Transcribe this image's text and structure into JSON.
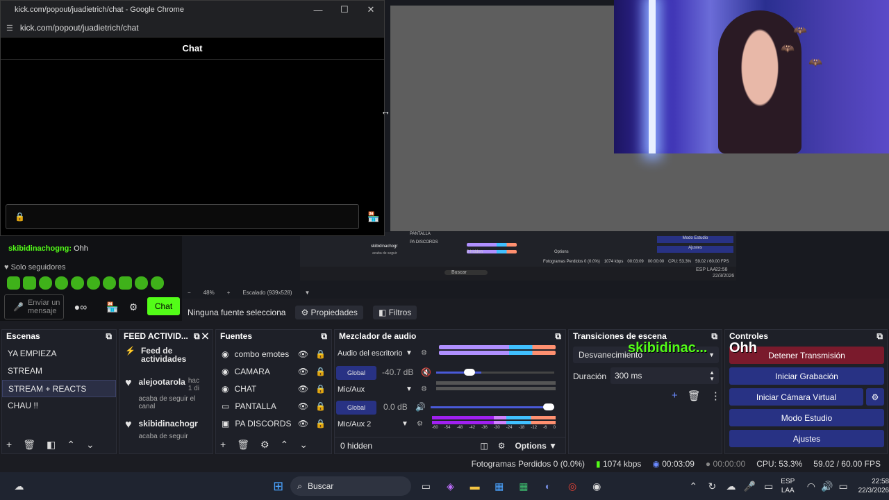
{
  "chrome_window": {
    "title": "kick.com/popout/juadietrich/chat - Google Chrome",
    "url": "kick.com/popout/juadietrich/chat",
    "chat_header": "Chat",
    "minimize": "—",
    "maximize": "☐",
    "close": "✕"
  },
  "kick_chat": {
    "message_user": "skibidinachogng:",
    "message_text": "Ohh",
    "followers_only": "Solo seguidores",
    "send_placeholder": "Enviar un mensaje",
    "chat_button": "Chat"
  },
  "mini_obs": {
    "scene_a": "PANTALLA",
    "scene_b": "PA DISCORDS",
    "user": "skibidinachogr",
    "follow": "acaba de seguir",
    "modo_estudio": "Modo Estudio",
    "ajustes": "Ajustes",
    "hidden": "0 hidden",
    "options": "Options",
    "search": "Buscar",
    "status": "Fotogramas Perdidos 0 (0.0%)",
    "kbps": "1074 kbps",
    "time1": "00:03:09",
    "time2": "00:00:00",
    "cpu": "CPU: 53.3%",
    "fps": "59.02 / 60.00 FPS",
    "lang": "ESP LAA",
    "clock": "22:58",
    "date": "22/3/2026"
  },
  "preview_toolbar": {
    "zoom": "48%",
    "scale": "Escalado (939x528)"
  },
  "source_bar": {
    "none_selected": "Ninguna fuente selecciona",
    "properties": "Propiedades",
    "filters": "Filtros"
  },
  "scenes": {
    "title": "Escenas",
    "items": [
      "YA EMPIEZA",
      "STREAM",
      "STREAM + REACTS",
      "CHAU !!"
    ],
    "selected_index": 2
  },
  "activity": {
    "title": "FEED ACTIVID...",
    "feed_label": "Feed de actividades",
    "entries": [
      {
        "user": "alejootarola",
        "time": "hac 1 di",
        "text": "acaba de seguir el canal"
      },
      {
        "user": "skibidinachogr",
        "text": "acaba de seguir"
      }
    ]
  },
  "sources": {
    "title": "Fuentes",
    "items": [
      "combo emotes",
      "CAMARA",
      "CHAT",
      "PANTALLA",
      "PA DISCORDS"
    ]
  },
  "mixer": {
    "title": "Mezclador de audio",
    "tracks": [
      {
        "name": "Audio del escritorio",
        "db": "-40.7 dB",
        "muted": true,
        "level": 0.55
      },
      {
        "name": "Mic/Aux",
        "db": "0.0 dB",
        "muted": false,
        "level": 1.0
      },
      {
        "name": "Mic/Aux 2"
      }
    ],
    "global_label": "Global",
    "ticks": [
      "-60",
      "-54",
      "-48",
      "-42",
      "-36",
      "-30",
      "-24",
      "-18",
      "-12",
      "-6",
      "0"
    ],
    "hidden": "0 hidden",
    "options": "Options"
  },
  "transitions": {
    "title": "Transiciones de escena",
    "type": "Desvanecimiento",
    "duration_label": "Duración",
    "duration_value": "300 ms"
  },
  "overlay": {
    "name": "skibidinac...",
    "message": "Ohh"
  },
  "controls": {
    "title": "Controles",
    "buttons": [
      "Detener Transmisión",
      "Iniciar Grabación",
      "Iniciar Cámara Virtual",
      "Modo Estudio",
      "Ajustes"
    ]
  },
  "status": {
    "dropped": "Fotogramas Perdidos 0 (0.0%)",
    "kbps": "1074 kbps",
    "stream_time": "00:03:09",
    "rec_time": "00:00:00",
    "cpu": "CPU: 53.3%",
    "fps": "59.02 / 60.00 FPS"
  },
  "taskbar": {
    "search": "Buscar",
    "lang_top": "ESP",
    "lang_bottom": "LAA",
    "time": "22:58",
    "date": "22/3/2026"
  },
  "colors": {
    "kick_green": "#53fc18",
    "obs_blue": "#283284",
    "stop_red": "#7a1a2c"
  }
}
